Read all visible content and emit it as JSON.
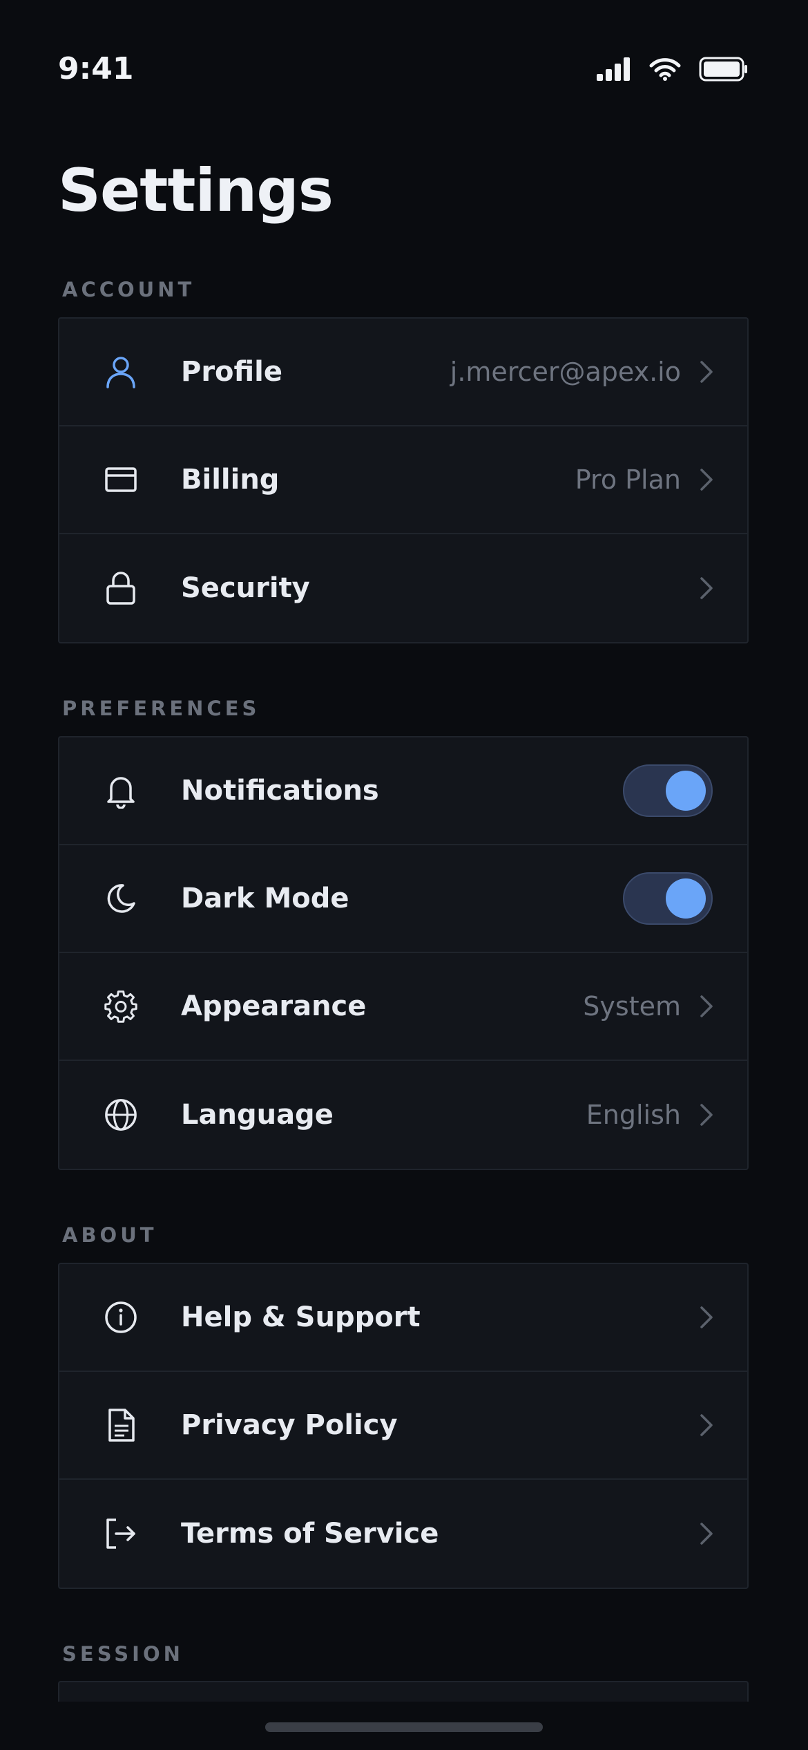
{
  "status_bar": {
    "time": "9:41"
  },
  "page": {
    "title": "Settings"
  },
  "colors": {
    "accent": "#6aa5f8",
    "background": "#0a0c10",
    "card": "#12151b",
    "muted": "#6e7480"
  },
  "sections": {
    "account": {
      "label": "ACCOUNT",
      "profile": {
        "icon": "user-icon",
        "label": "Profile",
        "value": "j.mercer@apex.io"
      },
      "billing": {
        "icon": "credit-card-icon",
        "label": "Billing",
        "value": "Pro Plan"
      },
      "security": {
        "icon": "lock-icon",
        "label": "Security"
      }
    },
    "preferences": {
      "label": "PREFERENCES",
      "notifications": {
        "icon": "bell-icon",
        "label": "Notifications",
        "enabled": true
      },
      "dark_mode": {
        "icon": "moon-icon",
        "label": "Dark Mode",
        "enabled": true
      },
      "appearance": {
        "icon": "gear-icon",
        "label": "Appearance",
        "value": "System"
      },
      "language": {
        "icon": "globe-icon",
        "label": "Language",
        "value": "English"
      }
    },
    "about": {
      "label": "ABOUT",
      "help": {
        "icon": "info-icon",
        "label": "Help & Support"
      },
      "privacy": {
        "icon": "document-icon",
        "label": "Privacy Policy"
      },
      "terms": {
        "icon": "exit-icon",
        "label": "Terms of Service"
      }
    },
    "session": {
      "label": "SESSION"
    }
  }
}
